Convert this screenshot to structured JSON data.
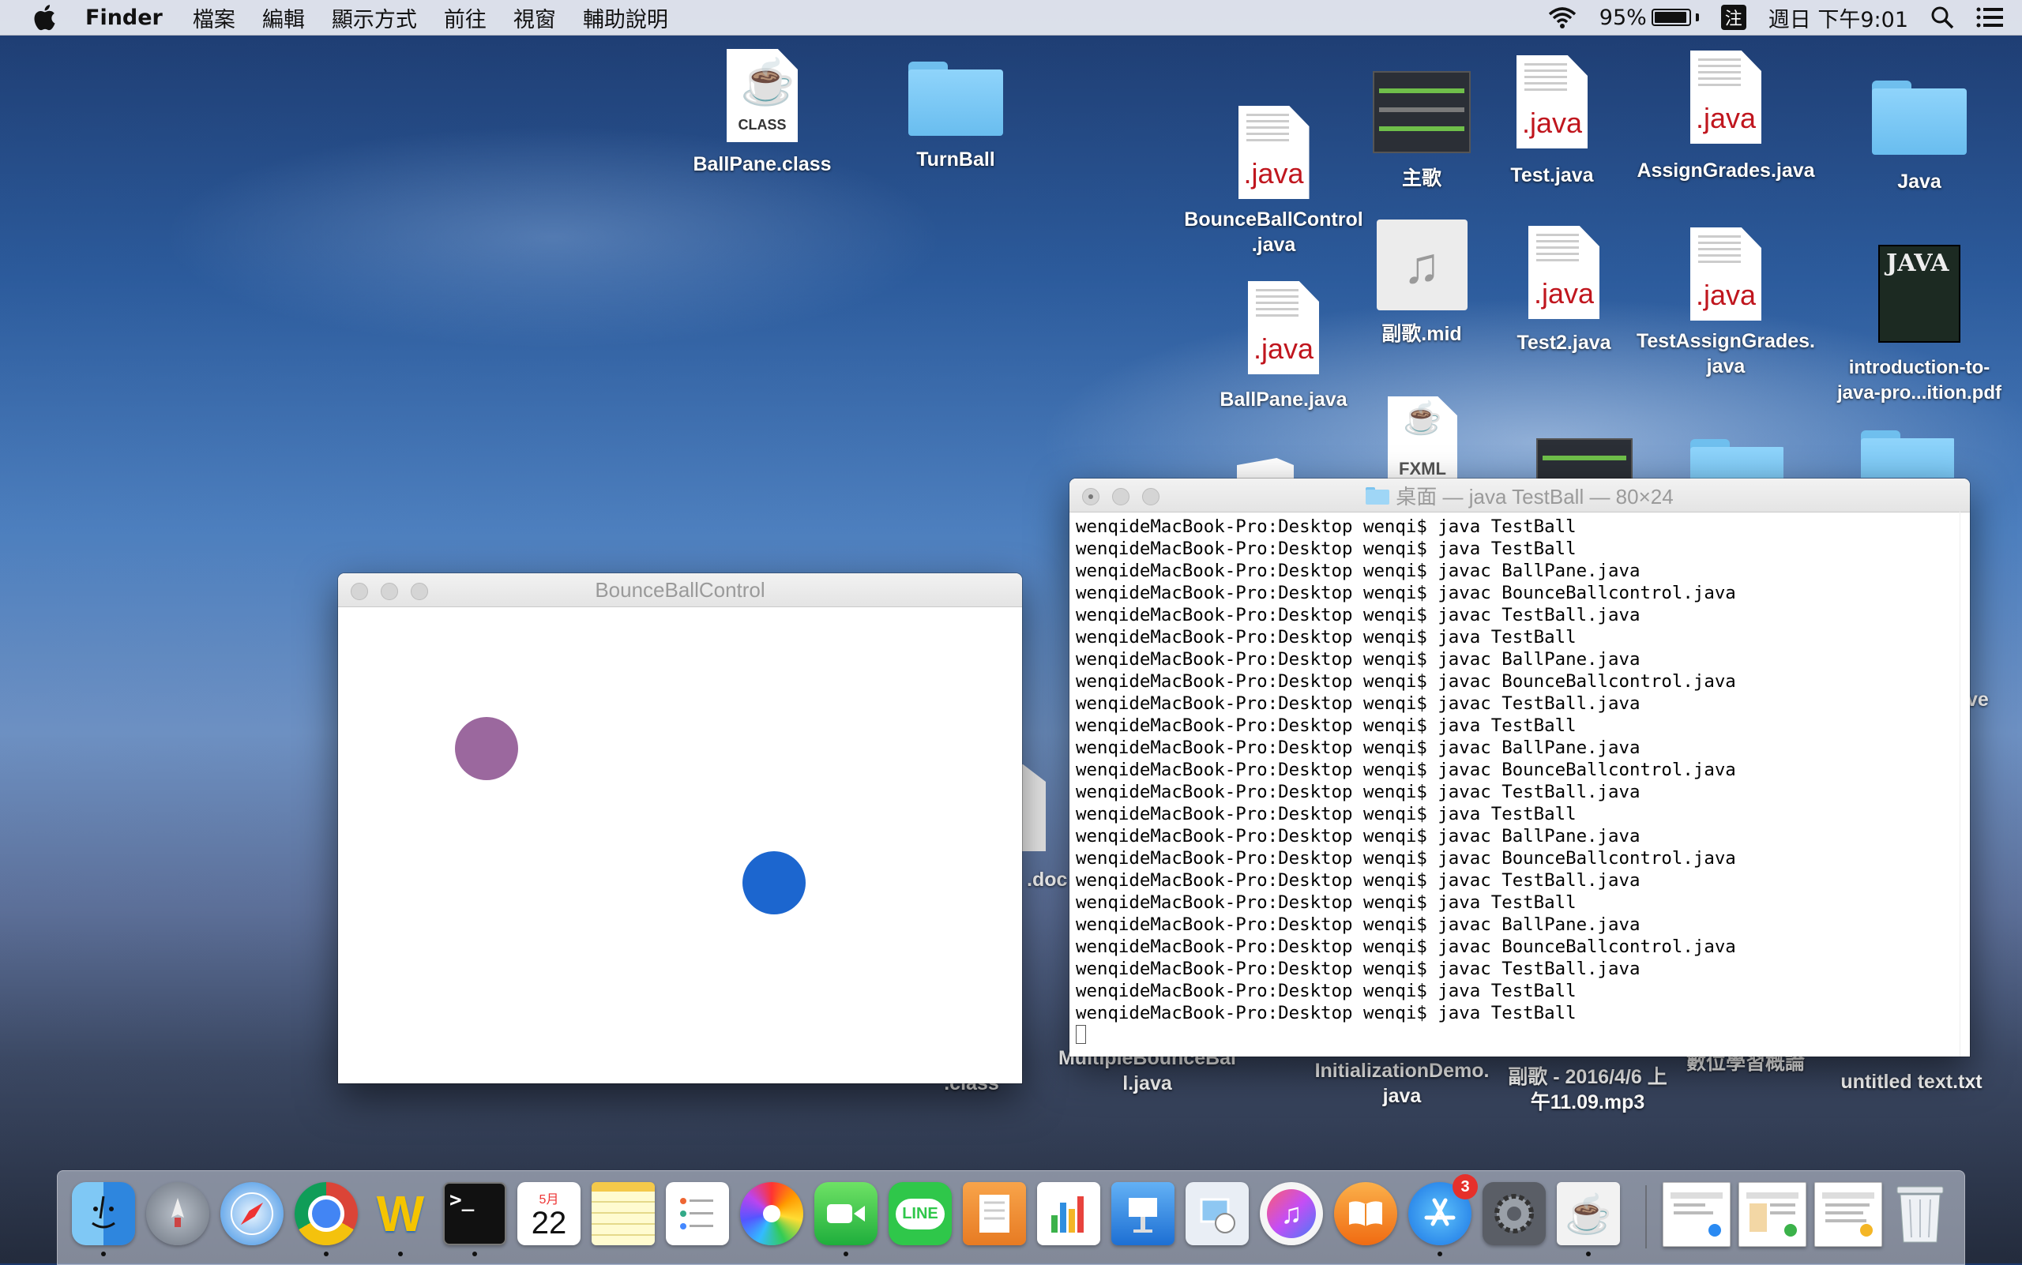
{
  "menubar": {
    "app": "Finder",
    "items": [
      "檔案",
      "編輯",
      "顯示方式",
      "前往",
      "視窗",
      "輔助說明"
    ],
    "battery_percent": "95%",
    "battery_level": 0.95,
    "ime": "注",
    "clock": "週日 下午9:01"
  },
  "desktop": {
    "ballpane_class": "BallPane.class",
    "turnball": "TurnBall",
    "bounceballcontrol_java": "BounceBallControl\n.java",
    "zhuge": "主歌",
    "test_java": "Test.java",
    "assigngrades_java": "AssignGrades.java",
    "java_folder": "Java",
    "fuge_mid": "副歌.mid",
    "test2_java": "Test2.java",
    "testassigngrades_java": "TestAssignGrades.\njava",
    "ballpane_java": "BallPane.java",
    "intro_pdf": "introduction-to-\njava-pro...ition.pdf",
    "partial_ve": "ve",
    "partial_doc": ".doc",
    "partial_class": "rol\n.class",
    "multiplebounce": "MultipleBounceBal\nl.java",
    "initialization": "InitializationDemo.\njava",
    "fuge_mp3": "副歌 - 2016/4/6 上\n午11.09.mp3",
    "digital_learning": "數位學習概論",
    "untitled_txt": "untitled text.txt",
    "ext_java": ".java",
    "ext_class": "CLASS",
    "fxml": "FXML",
    "book_title": "JAVA"
  },
  "bounce_window": {
    "title": "BounceBallControl",
    "balls": [
      {
        "name": "purple-ball",
        "color": "#9b689e"
      },
      {
        "name": "blue-ball",
        "color": "#1c66cf"
      }
    ]
  },
  "terminal": {
    "title": "桌面 — java TestBall — 80×24",
    "lines": [
      "wenqideMacBook-Pro:Desktop wenqi$ java TestBall",
      "wenqideMacBook-Pro:Desktop wenqi$ java TestBall",
      "wenqideMacBook-Pro:Desktop wenqi$ javac BallPane.java",
      "wenqideMacBook-Pro:Desktop wenqi$ javac BounceBallcontrol.java",
      "wenqideMacBook-Pro:Desktop wenqi$ javac TestBall.java",
      "wenqideMacBook-Pro:Desktop wenqi$ java TestBall",
      "wenqideMacBook-Pro:Desktop wenqi$ javac BallPane.java",
      "wenqideMacBook-Pro:Desktop wenqi$ javac BounceBallcontrol.java",
      "wenqideMacBook-Pro:Desktop wenqi$ javac TestBall.java",
      "wenqideMacBook-Pro:Desktop wenqi$ java TestBall",
      "wenqideMacBook-Pro:Desktop wenqi$ javac BallPane.java",
      "wenqideMacBook-Pro:Desktop wenqi$ javac BounceBallcontrol.java",
      "wenqideMacBook-Pro:Desktop wenqi$ javac TestBall.java",
      "wenqideMacBook-Pro:Desktop wenqi$ java TestBall",
      "wenqideMacBook-Pro:Desktop wenqi$ javac BallPane.java",
      "wenqideMacBook-Pro:Desktop wenqi$ javac BounceBallcontrol.java",
      "wenqideMacBook-Pro:Desktop wenqi$ javac TestBall.java",
      "wenqideMacBook-Pro:Desktop wenqi$ java TestBall",
      "wenqideMacBook-Pro:Desktop wenqi$ javac BallPane.java",
      "wenqideMacBook-Pro:Desktop wenqi$ javac BounceBallcontrol.java",
      "wenqideMacBook-Pro:Desktop wenqi$ javac TestBall.java",
      "wenqideMacBook-Pro:Desktop wenqi$ java TestBall",
      "wenqideMacBook-Pro:Desktop wenqi$ java TestBall"
    ]
  },
  "dock": {
    "calendar_month": "5月",
    "calendar_day": "22",
    "app_store_badge": "3",
    "line_label": "LINE",
    "terminal_prompt": ">_"
  }
}
